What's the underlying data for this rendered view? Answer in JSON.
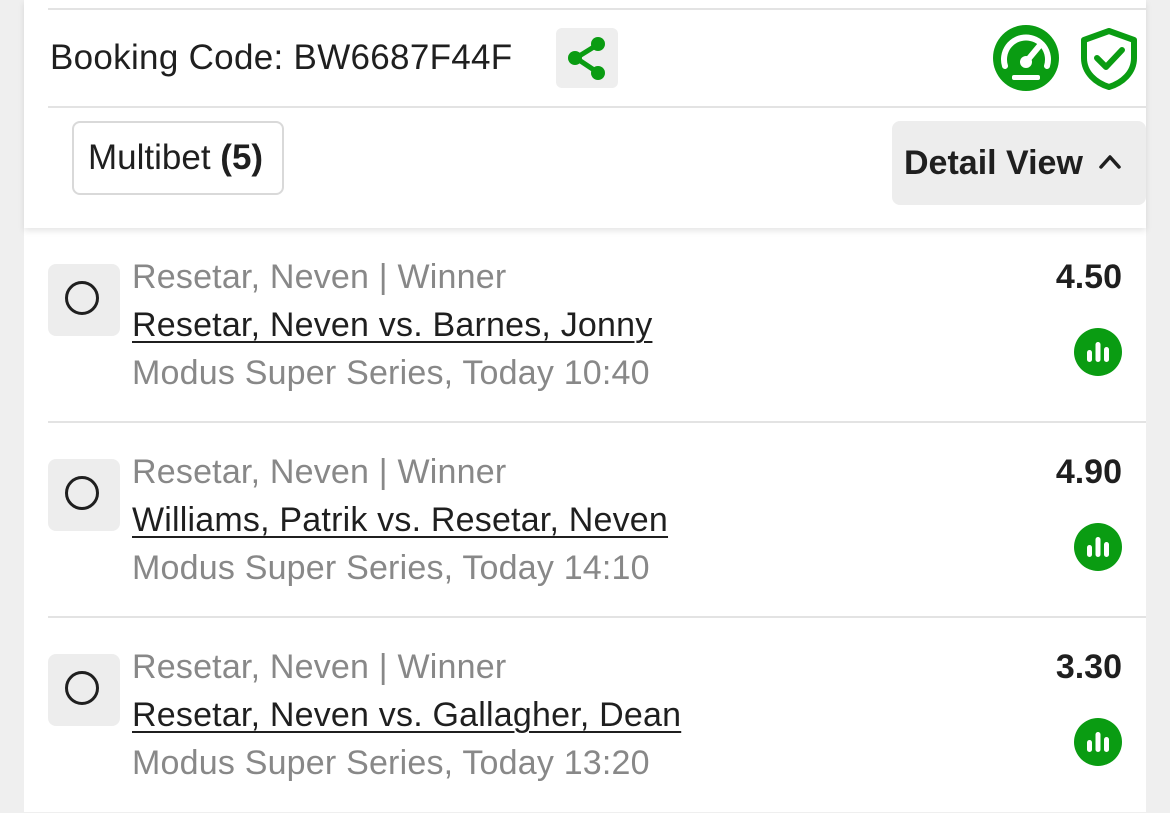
{
  "booking": {
    "label": "Booking Code:",
    "code": "BW6687F44F",
    "share_icon": "share-icon",
    "gauge_icon": "speedometer-icon",
    "shield_icon": "shield-check-icon"
  },
  "bet": {
    "type_label": "Multibet",
    "count": "(5)",
    "view_label": "Detail View",
    "view_icon": "chevron-up-icon"
  },
  "colors": {
    "accent": "#0a9c12",
    "text": "#1f1f1f",
    "muted": "#888888"
  },
  "selections": [
    {
      "market": "Resetar, Neven | Winner",
      "match": "Resetar, Neven vs. Barnes, Jonny",
      "event": "Modus Super Series, Today 10:40",
      "odds": "4.50"
    },
    {
      "market": "Resetar, Neven | Winner",
      "match": "Williams, Patrik vs. Resetar, Neven",
      "event": "Modus Super Series, Today 14:10",
      "odds": "4.90"
    },
    {
      "market": "Resetar, Neven | Winner",
      "match": "Resetar, Neven vs. Gallagher, Dean",
      "event": "Modus Super Series, Today 13:20",
      "odds": "3.30"
    }
  ]
}
